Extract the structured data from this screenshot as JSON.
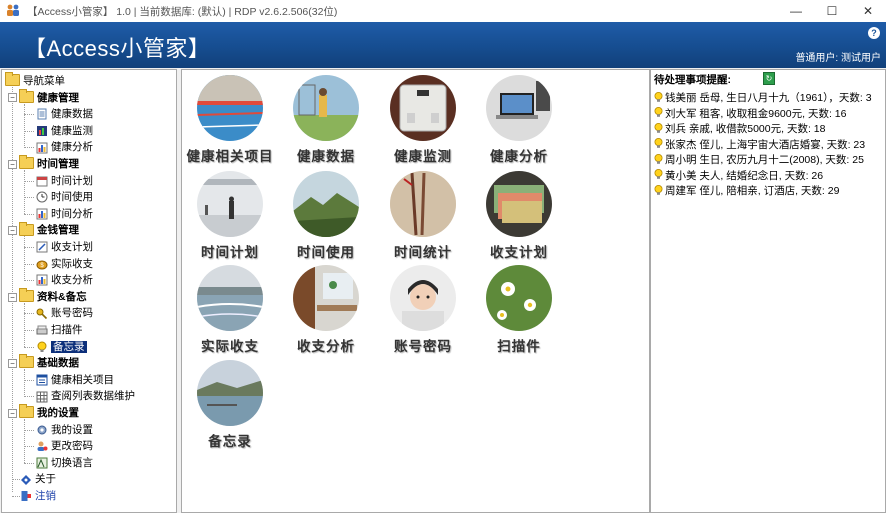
{
  "window": {
    "title": "【Access小管家】 1.0 | 当前数据库: (默认) | RDP v2.6.2.506(32位)",
    "minimize_glyph": "—",
    "maximize_glyph": "☐",
    "close_glyph": "✕"
  },
  "header": {
    "title": "【Access小管家】",
    "user_info": "普通用户: 测试用户",
    "help_glyph": "?"
  },
  "nav": {
    "root": "导航菜单",
    "groups": [
      {
        "label": "健康管理",
        "items": [
          "健康数据",
          "健康监测",
          "健康分析"
        ]
      },
      {
        "label": "时间管理",
        "items": [
          "时间计划",
          "时间使用",
          "时间分析"
        ]
      },
      {
        "label": "金钱管理",
        "items": [
          "收支计划",
          "实际收支",
          "收支分析"
        ]
      },
      {
        "label": "资料&备忘",
        "items": [
          "账号密码",
          "扫描件",
          "备忘录"
        ]
      },
      {
        "label": "基础数据",
        "items": [
          "健康相关项目",
          "查阅列表数据维护"
        ]
      },
      {
        "label": "我的设置",
        "items": [
          "我的设置",
          "更改密码",
          "切换语言"
        ]
      }
    ],
    "about": "关于",
    "logout": "注销",
    "selected": "备忘录"
  },
  "tiles": [
    {
      "label": "健康相关项目",
      "icon": "swimming-pool-photo"
    },
    {
      "label": "健康数据",
      "icon": "tennis-player-photo"
    },
    {
      "label": "健康监测",
      "icon": "scale-photo"
    },
    {
      "label": "健康分析",
      "icon": "laptop-desk-photo"
    },
    {
      "label": "时间计划",
      "icon": "airport-hall-photo"
    },
    {
      "label": "时间使用",
      "icon": "mountain-photo"
    },
    {
      "label": "时间统计",
      "icon": "chopsticks-photo"
    },
    {
      "label": "收支计划",
      "icon": "banknotes-photo"
    },
    {
      "label": "实际收支",
      "icon": "river-dam-photo"
    },
    {
      "label": "收支分析",
      "icon": "office-photo"
    },
    {
      "label": "账号密码",
      "icon": "child-photo"
    },
    {
      "label": "扫描件",
      "icon": "daisies-photo"
    },
    {
      "label": "备忘录",
      "icon": "lake-photo"
    }
  ],
  "todo": {
    "heading": "待处理事项提醒:",
    "items": [
      "钱美丽 岳母, 生日八月十九（1961），天数: 3",
      "刘大军 租客, 收取租金9600元, 天数: 16",
      "刘兵 亲戚, 收借款5000元, 天数: 18",
      "张家杰 侄儿, 上海宇宙大酒店婚宴, 天数: 23",
      "周小明 生日, 农历九月十二(2008), 天数: 25",
      "黄小美 夫人, 结婚纪念日, 天数: 26",
      "周建军 侄儿, 陪相亲, 订酒店, 天数: 29"
    ]
  },
  "colors": {
    "header_blue": "#1a5196",
    "selected_bg": "#0c2f7a"
  }
}
